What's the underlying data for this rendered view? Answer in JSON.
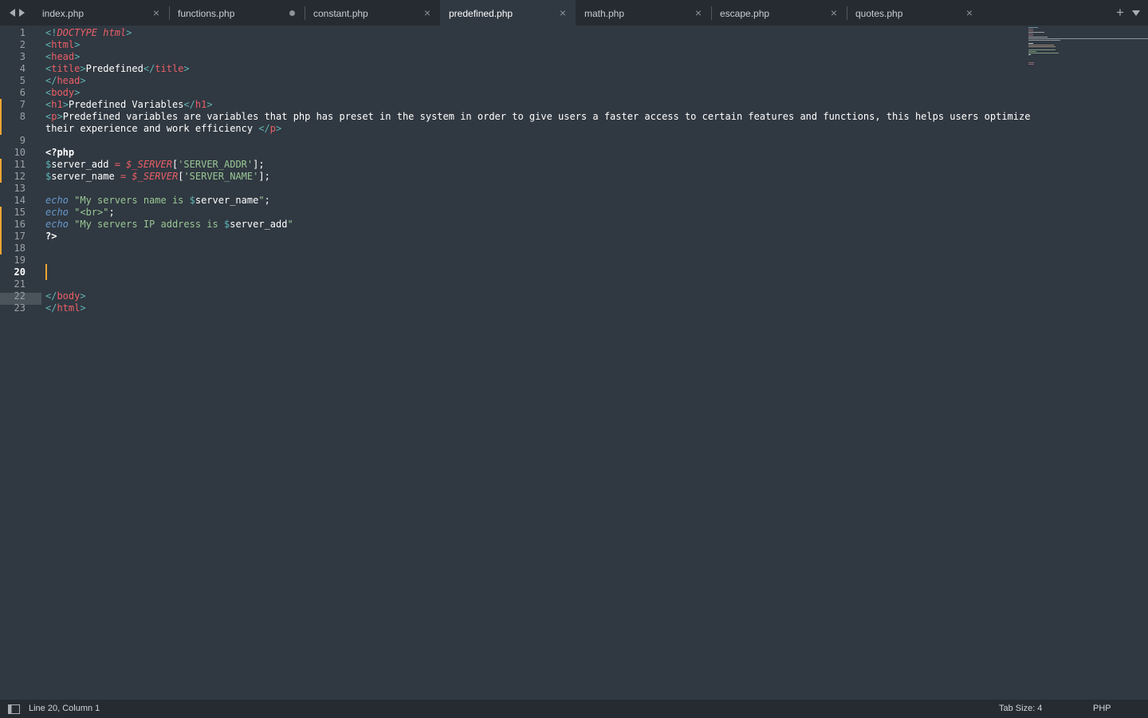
{
  "tabs": [
    {
      "label": "index.php",
      "state": "saved",
      "active": false
    },
    {
      "label": "functions.php",
      "state": "unsaved",
      "active": false
    },
    {
      "label": "constant.php",
      "state": "saved",
      "active": false
    },
    {
      "label": "predefined.php",
      "state": "saved",
      "active": true
    },
    {
      "label": "math.php",
      "state": "saved",
      "active": false
    },
    {
      "label": "escape.php",
      "state": "saved",
      "active": false
    },
    {
      "label": "quotes.php",
      "state": "saved",
      "active": false
    }
  ],
  "tab_icons": {
    "close": "close-icon",
    "unsaved": "unsaved-dot-icon",
    "back": "chevron-left-icon",
    "forward": "chevron-right-icon",
    "new_tab": "plus-icon",
    "tab_menu": "chevron-down-icon"
  },
  "line_numbers": [
    "1",
    "2",
    "3",
    "4",
    "5",
    "6",
    "7",
    "8",
    "9",
    "10",
    "11",
    "12",
    "13",
    "14",
    "15",
    "16",
    "17",
    "18",
    "19",
    "20",
    "21",
    "22",
    "23"
  ],
  "current_line": "20",
  "code": {
    "l1_a": "<!",
    "l1_b": "DOCTYPE",
    "l1_c": " html",
    "l1_d": ">",
    "l2_a": "<",
    "l2_b": "html",
    "l2_c": ">",
    "l3_a": "<",
    "l3_b": "head",
    "l3_c": ">",
    "l4_a": "<",
    "l4_b": "title",
    "l4_c": ">",
    "l4_d": "Predefined",
    "l4_e": "</",
    "l4_f": "title",
    "l4_g": ">",
    "l5_a": "</",
    "l5_b": "head",
    "l5_c": ">",
    "l6_a": "<",
    "l6_b": "body",
    "l6_c": ">",
    "l7_a": "<",
    "l7_b": "h1",
    "l7_c": ">",
    "l7_d": "Predefined Variables",
    "l7_e": "</",
    "l7_f": "h1",
    "l7_g": ">",
    "l8_a": "<",
    "l8_b": "p",
    "l8_c": ">",
    "l8_d": "Predefined variables are variables that php has preset in the system in order to give users a faster access to certain features and functions, this helps users optimize",
    "l8w_a": "their experience and work efficiency ",
    "l8w_b": "</",
    "l8w_c": "p",
    "l8w_d": ">",
    "l10": "<?php",
    "l11_a": "$",
    "l11_b": "server_add",
    "l11_c": " = ",
    "l11_d": "$_SERVER",
    "l11_e": "[",
    "l11_f": "'SERVER_ADDR'",
    "l11_g": "];",
    "l12_a": "$",
    "l12_b": "server_name",
    "l12_c": " = ",
    "l12_d": "$_SERVER",
    "l12_e": "[",
    "l12_f": "'SERVER_NAME'",
    "l12_g": "];",
    "l14_a": "echo",
    "l14_b": " \"My servers name is ",
    "l14_c": "$",
    "l14_d": "server_name",
    "l14_e": "\"",
    "l14_f": ";",
    "l15_a": "echo",
    "l15_b": " \"<br>\"",
    "l15_c": ";",
    "l16_a": "echo",
    "l16_b": " \"My servers IP address is ",
    "l16_c": "$",
    "l16_d": "server_add",
    "l16_e": "\"",
    "l17": "?>",
    "l22_a": "</",
    "l22_b": "body",
    "l22_c": ">",
    "l23_a": "</",
    "l23_b": "html",
    "l23_c": ">"
  },
  "status": {
    "sidebar_icon": "sidebar-toggle-icon",
    "position": "Line 20, Column 1",
    "tab_size": "Tab Size: 4",
    "syntax": "PHP"
  },
  "colors": {
    "background": "#303841",
    "chrome": "#252b31",
    "tag": "#5fb4b4",
    "tag_name": "#ec5f67",
    "string": "#99c794",
    "keyword": "#6699cc",
    "modified_marker": "#f5a533",
    "cursor": "#f5a533"
  }
}
